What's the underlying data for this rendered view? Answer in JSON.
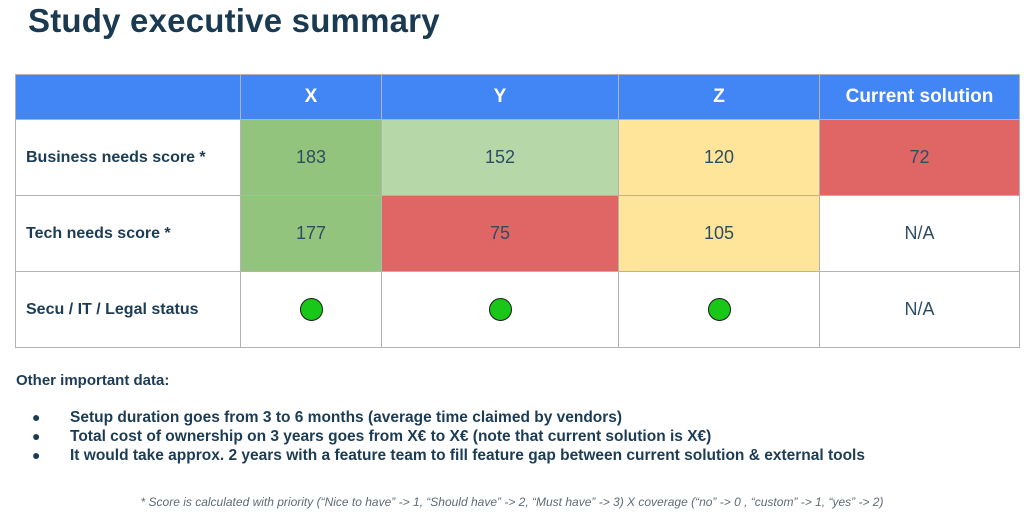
{
  "title": "Study executive summary",
  "table": {
    "headers": [
      "",
      "X",
      "Y",
      "Z",
      "Current solution"
    ],
    "rows": [
      {
        "label": "Business needs score *",
        "cells": [
          {
            "value": "183",
            "color": "#93c47d"
          },
          {
            "value": "152",
            "color": "#b6d7a8"
          },
          {
            "value": "120",
            "color": "#ffe599"
          },
          {
            "value": "72",
            "color": "#e06666"
          }
        ]
      },
      {
        "label": "Tech needs score *",
        "cells": [
          {
            "value": "177",
            "color": "#93c47d"
          },
          {
            "value": "75",
            "color": "#e06666"
          },
          {
            "value": "105",
            "color": "#ffe599"
          },
          {
            "value": "N/A",
            "color": "#ffffff"
          }
        ]
      },
      {
        "label": "Secu / IT / Legal status",
        "cells": [
          {
            "value": "green-status-dot",
            "icon": "status-ok-icon",
            "color": "#18c718"
          },
          {
            "value": "green-status-dot",
            "icon": "status-ok-icon",
            "color": "#18c718"
          },
          {
            "value": "green-status-dot",
            "icon": "status-ok-icon",
            "color": "#18c718"
          },
          {
            "value": "N/A"
          }
        ]
      }
    ]
  },
  "other": {
    "heading": "Other important data:",
    "bullet_glyph": "●",
    "items": [
      "Setup duration goes from 3 to 6 months (average time claimed by vendors)",
      "Total cost of ownership on 3 years goes from X€ to X€ (note that current solution is X€)",
      "It would take approx. 2 years with a feature team to fill feature gap between current solution & external tools"
    ]
  },
  "footnote": "* Score is calculated with priority (“Nice to have” -> 1, “Should have” -> 2, “Must have” -> 3) X coverage (“no” -> 0 , “custom” -> 1, “yes” -> 2)",
  "colors": {
    "header_blue": "#4285f4",
    "title_navy": "#1a3a52",
    "dark_green": "#93c47d",
    "light_green": "#b6d7a8",
    "yellow": "#ffe599",
    "red": "#e06666",
    "status_green": "#18c718"
  }
}
